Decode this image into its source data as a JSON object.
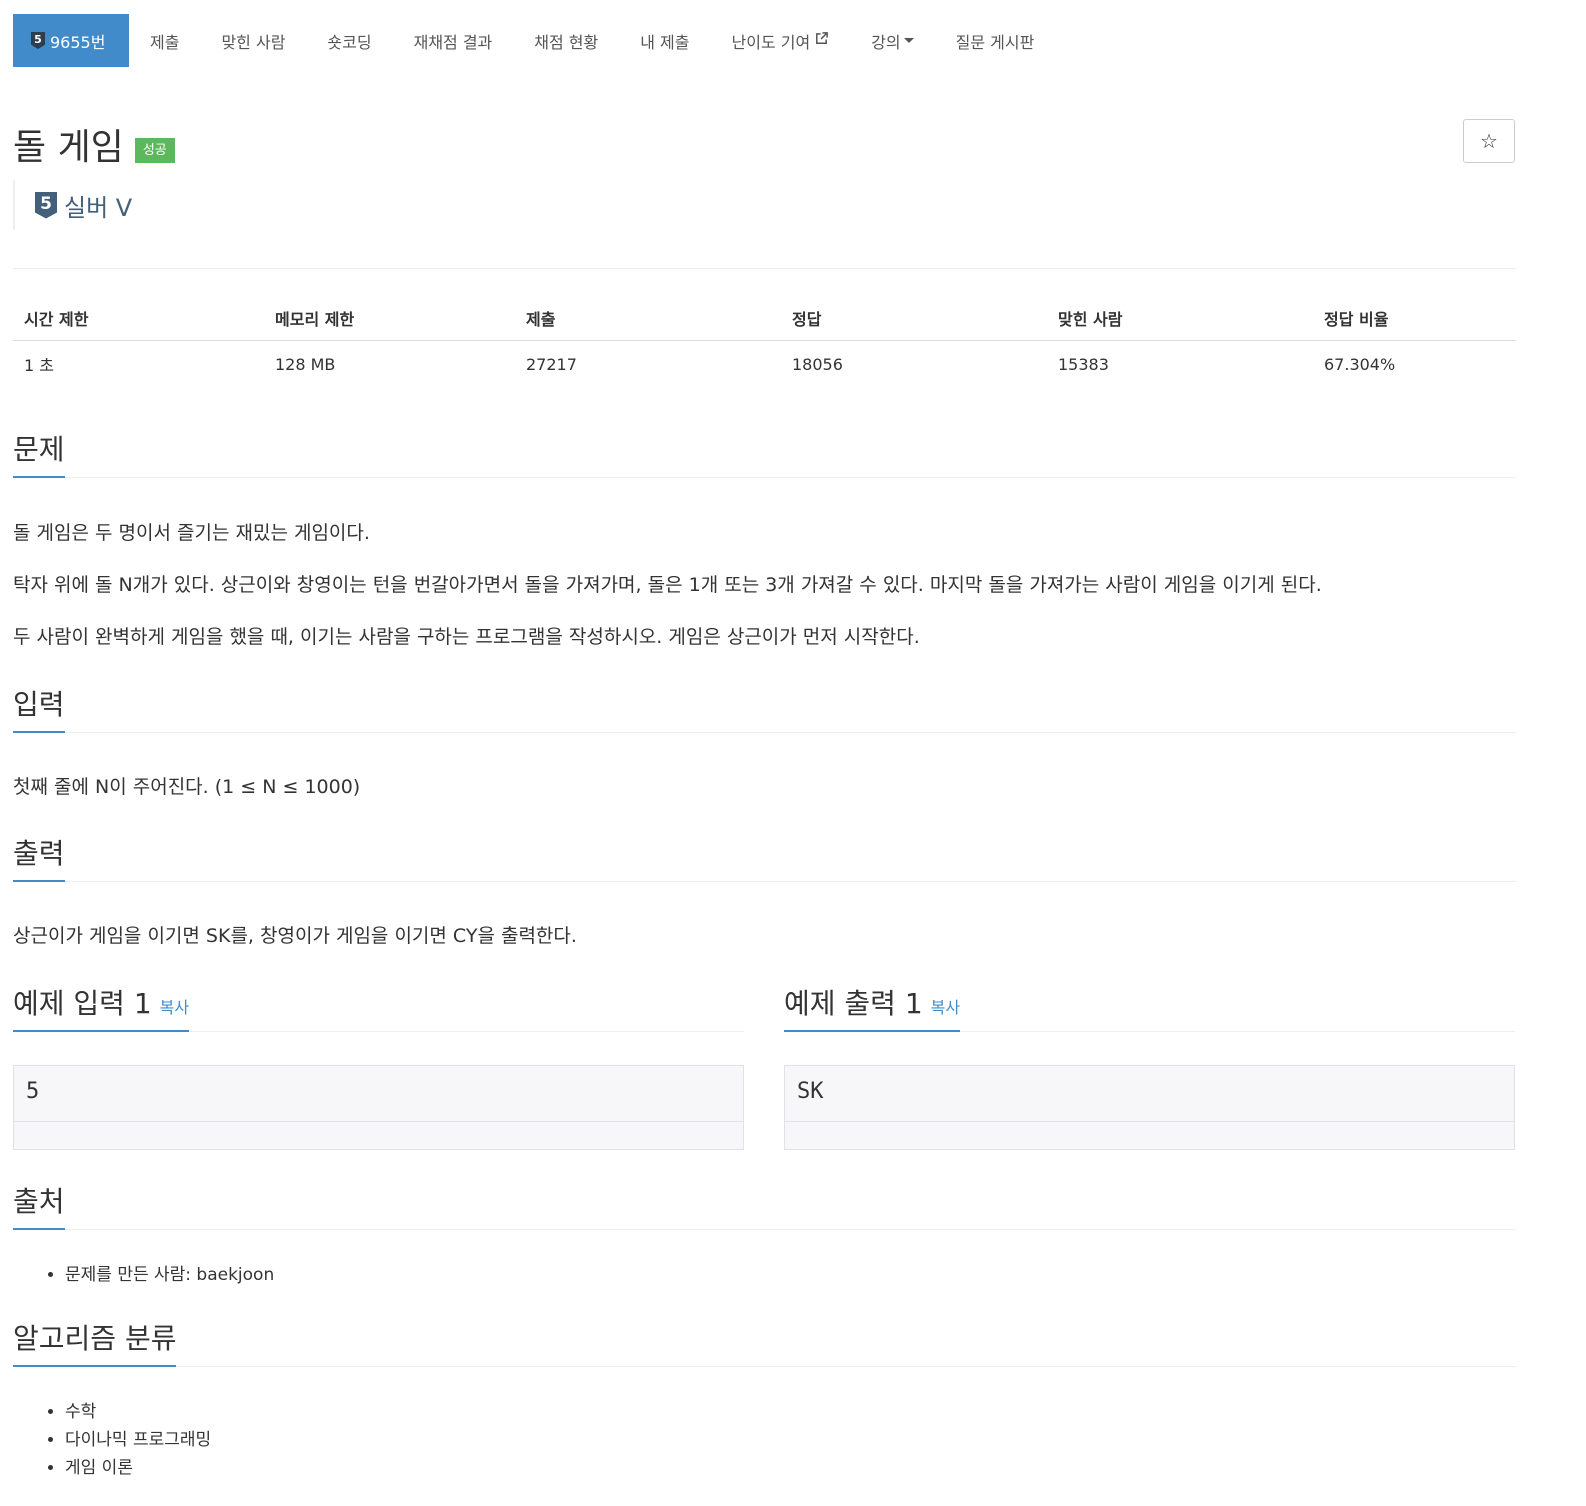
{
  "nav": {
    "problem_tier_badge": "5",
    "problem_number": "9655번",
    "items": [
      "제출",
      "맞힌 사람",
      "숏코딩",
      "재채점 결과",
      "채점 현황",
      "내 제출",
      "난이도 기여",
      "강의",
      "질문 게시판"
    ]
  },
  "problem": {
    "title": "돌 게임",
    "status_label": "성공",
    "tier_badge": "5",
    "tier_name": "실버 V",
    "star_glyph": "☆"
  },
  "info_table": {
    "headers": [
      "시간 제한",
      "메모리 제한",
      "제출",
      "정답",
      "맞힌 사람",
      "정답 비율"
    ],
    "values": [
      "1 초",
      "128 MB",
      "27217",
      "18056",
      "15383",
      "67.304%"
    ]
  },
  "description": {
    "heading": "문제",
    "paragraphs": [
      "돌 게임은 두 명이서 즐기는 재밌는 게임이다.",
      "탁자 위에 돌 N개가 있다. 상근이와 창영이는 턴을 번갈아가면서 돌을 가져가며, 돌은 1개 또는 3개 가져갈 수 있다. 마지막 돌을 가져가는 사람이 게임을 이기게 된다.",
      "두 사람이 완벽하게 게임을 했을 때, 이기는 사람을 구하는 프로그램을 작성하시오. 게임은 상근이가 먼저 시작한다."
    ]
  },
  "input": {
    "heading": "입력",
    "text": "첫째 줄에 N이 주어진다. (1 ≤ N ≤ 1000)"
  },
  "output": {
    "heading": "출력",
    "text": "상근이가 게임을 이기면 SK를, 창영이가 게임을 이기면 CY을 출력한다."
  },
  "samples": {
    "input_heading": "예제 입력 1",
    "output_heading": "예제 출력 1",
    "copy_label": "복사",
    "input_value": "5",
    "output_value": "SK"
  },
  "source": {
    "heading": "출처",
    "items": [
      "문제를 만든 사람: baekjoon"
    ]
  },
  "tags": {
    "heading": "알고리즘 분류",
    "items": [
      "수학",
      "다이나믹 프로그래밍",
      "게임 이론"
    ]
  },
  "colors": {
    "accent": "#428bca",
    "success": "#5cb85c",
    "silver_tier": "#435f7a"
  }
}
